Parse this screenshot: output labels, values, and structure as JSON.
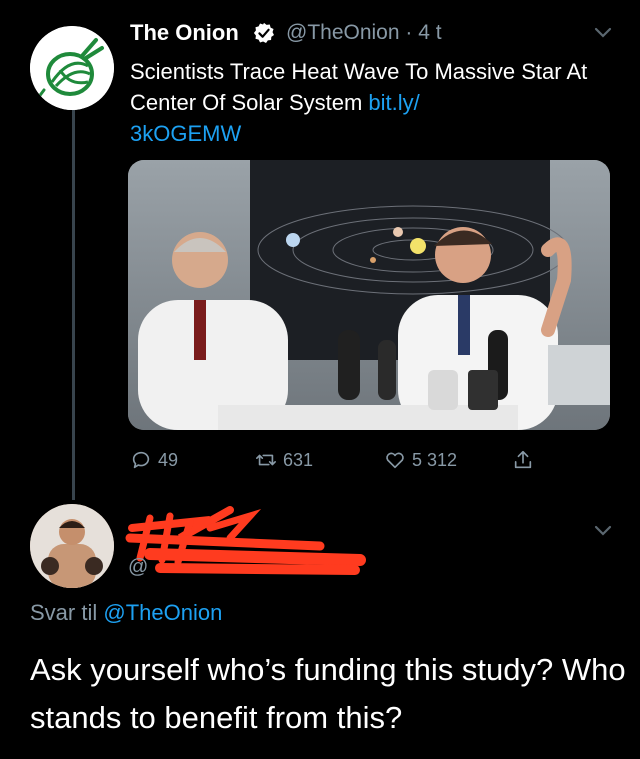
{
  "tweet": {
    "author_name": "The Onion",
    "handle": "@TheOnion",
    "separator": "·",
    "time": "4 t",
    "text": "Scientists Trace Heat Wave To Massive Star At Center Of Solar System ",
    "link": "bit.ly/\n3kOGEMW",
    "stats": {
      "replies": "49",
      "retweets": "631",
      "likes": "5 312"
    }
  },
  "reply": {
    "handle_prefix": "@",
    "reply_to_label": "Svar til ",
    "reply_to_mention": "@TheOnion",
    "text": "Ask yourself who’s funding this study? Who stands to benefit from this?"
  },
  "colors": {
    "background": "#000000",
    "secondary_text": "#8899a6",
    "link": "#1da1f2",
    "onion_green": "#1f8a3b",
    "redaction": "#ff3b1f"
  },
  "icons": [
    "verified-icon",
    "chevron-down-icon",
    "reply-icon",
    "retweet-icon",
    "like-icon",
    "share-icon"
  ]
}
